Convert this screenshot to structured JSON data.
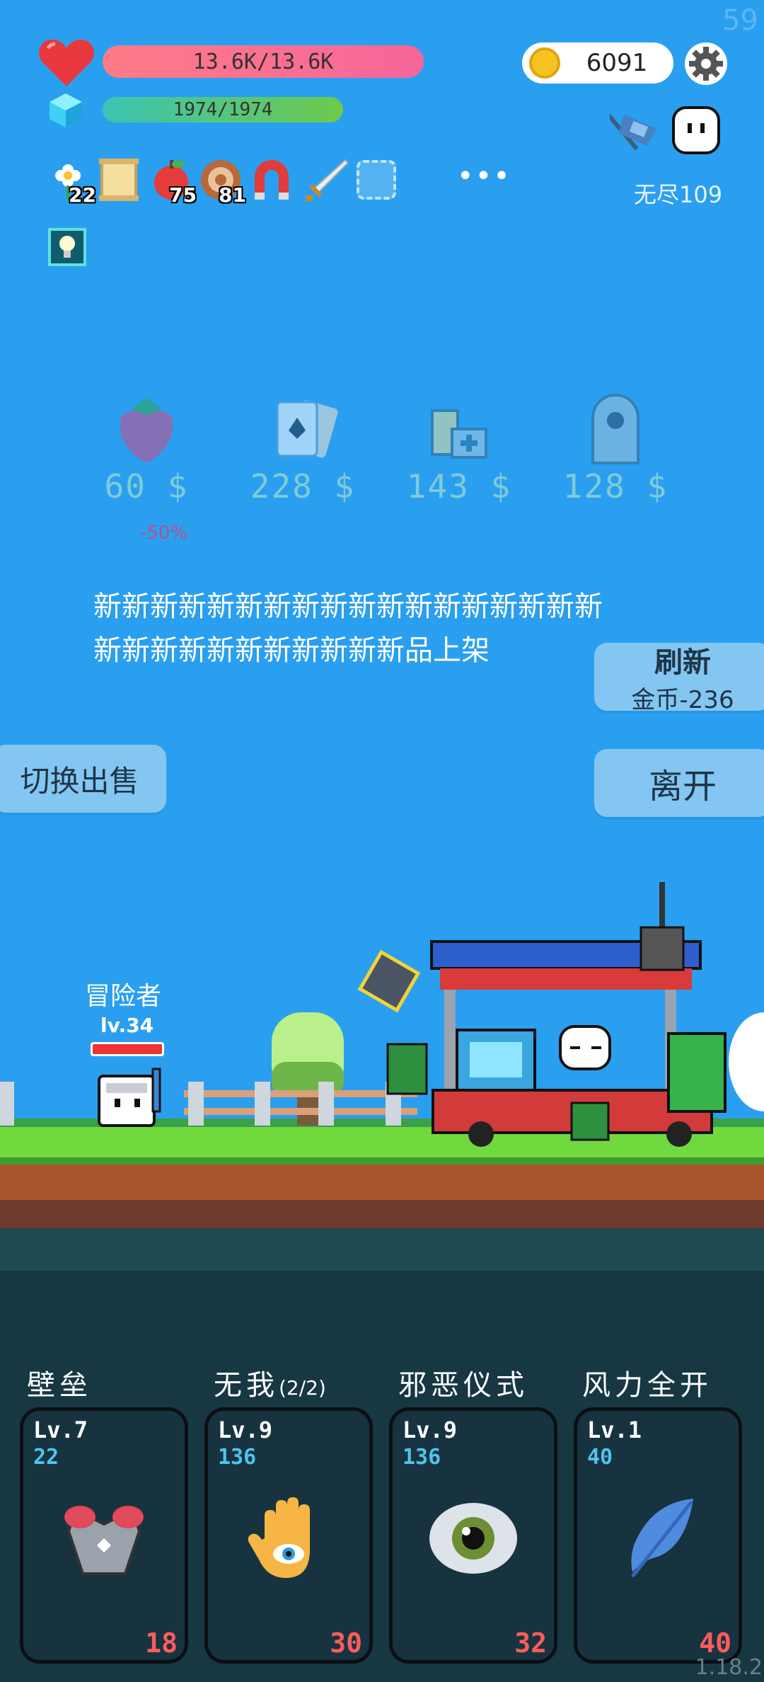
{
  "hud": {
    "fps": "59",
    "hp_text": "13.6K/13.6K",
    "mp_text": "1974/1974",
    "coins": "6091",
    "mode_label": "无尽109"
  },
  "items": [
    {
      "name": "flower-item-icon",
      "count": "22"
    },
    {
      "name": "scroll-item-icon",
      "count": ""
    },
    {
      "name": "apple-item-icon",
      "count": "75"
    },
    {
      "name": "target-item-icon",
      "count": "81"
    },
    {
      "name": "magnet-item-icon",
      "count": ""
    },
    {
      "name": "sword-item-icon",
      "count": ""
    },
    {
      "name": "empty-item-slot",
      "count": ""
    }
  ],
  "more_label": "•••",
  "shop": {
    "items": [
      {
        "name": "strawberry",
        "price": "60 $"
      },
      {
        "name": "cards",
        "price": "228 $"
      },
      {
        "name": "battery",
        "price": "143 $"
      },
      {
        "name": "tombstone",
        "price": "128 $"
      }
    ],
    "discount_label": "-50%",
    "dialog": "新新新新新新新新新新新新新新新新新新新新新新新新新新新新新品上架",
    "refresh_title": "刷新",
    "refresh_cost": "金币-236",
    "leave_label": "离开",
    "switch_label": "切换出售"
  },
  "hero": {
    "name": "冒险者",
    "level": "lv.34",
    "hp_fraction": 1.0
  },
  "skills": [
    {
      "title": "壁垒",
      "sub": "",
      "lv": "Lv.7",
      "value": "22",
      "cost": "18",
      "icon": "armor-icon"
    },
    {
      "title": "无我",
      "sub": "(2/2)",
      "lv": "Lv.9",
      "value": "136",
      "cost": "30",
      "icon": "hand-eye-icon"
    },
    {
      "title": "邪恶仪式",
      "sub": "",
      "lv": "Lv.9",
      "value": "136",
      "cost": "32",
      "icon": "eye-icon"
    },
    {
      "title": "风力全开",
      "sub": "",
      "lv": "Lv.1",
      "value": "40",
      "cost": "40",
      "icon": "feather-icon"
    }
  ],
  "version": "1.18.2",
  "colors": {
    "sky": "#2a9ff0",
    "hp": "#f5669a",
    "mp": "#6dc94a",
    "skill_value": "#4fc3ef",
    "skill_cost": "#ff5b5b"
  }
}
